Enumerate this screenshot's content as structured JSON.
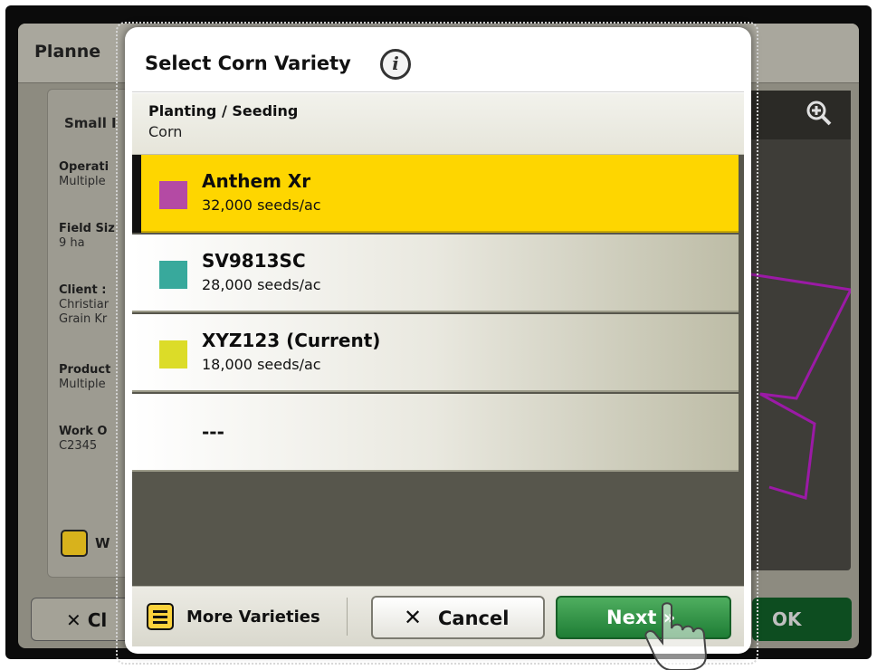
{
  "background": {
    "title": "Planne",
    "panel_title": "Small I",
    "fields": [
      {
        "label": "Operati",
        "value": "Multiple"
      },
      {
        "label": "Field Siz",
        "value": "9 ha"
      },
      {
        "label": "Client :",
        "value": "Christiar",
        "value2": "Grain Kr"
      },
      {
        "label": "Product",
        "value": "Multiple"
      },
      {
        "label": "Work O",
        "value": "C2345"
      }
    ],
    "work_button_label": "W",
    "close_label": "Cl",
    "ok_label": "OK"
  },
  "dialog": {
    "title": "Select Corn Variety",
    "operation": "Planting / Seeding",
    "crop": "Corn",
    "varieties": [
      {
        "name": "Anthem Xr",
        "rate": "32,000 seeds/ac",
        "color": "#b44aa4",
        "selected": true
      },
      {
        "name": "SV9813SC",
        "rate": "28,000 seeds/ac",
        "color": "#38a99c",
        "selected": false
      },
      {
        "name": "XYZ123 (Current)",
        "rate": "18,000 seeds/ac",
        "color": "#dcdc28",
        "selected": false
      }
    ],
    "empty_item": "---",
    "more_varieties": "More Varieties",
    "cancel": "Cancel",
    "next": "Next »"
  },
  "colors": {
    "selected_row": "#fed600",
    "next_green": "#2a8a3e",
    "boundary_magenta": "#9b1aa6"
  }
}
